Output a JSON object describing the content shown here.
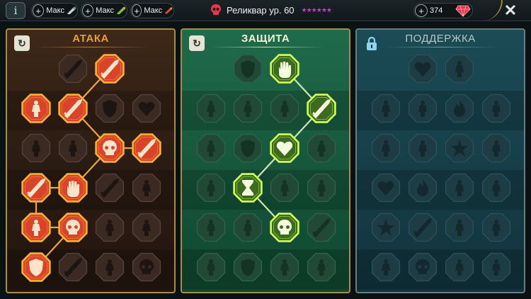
{
  "topbar": {
    "info_label": "i",
    "resources": [
      {
        "plus": "+",
        "label": "Макс",
        "icon": "silver-potion-icon"
      },
      {
        "plus": "+",
        "label": "Макс",
        "icon": "green-potion-icon"
      },
      {
        "plus": "+",
        "label": "Макс",
        "icon": "red-potion-icon"
      }
    ],
    "title": "Реликвар ур. 60",
    "stars": "★★★★★★",
    "gems_plus": "+",
    "gems_value": "374",
    "close_label": "✕",
    "colors": {
      "gem": "#e8364a",
      "stars": "#d233d8",
      "skull": "#e8364a"
    }
  },
  "panels": [
    {
      "id": "attack",
      "title": "АТАКА",
      "control": "reset",
      "control_glyph": "↻",
      "accent": "#f0902c",
      "nodes": [
        {
          "icon": "crossed-swords-icon",
          "state": "locked"
        },
        {
          "icon": "claw-slash-icon",
          "state": "active"
        },
        {
          "icon": "demon-icon",
          "state": "active"
        },
        {
          "icon": "blade-fan-icon",
          "state": "active"
        },
        {
          "icon": "shield-icon",
          "state": "locked"
        },
        {
          "icon": "heart-icon",
          "state": "locked"
        },
        {
          "icon": "warrior-icon",
          "state": "locked"
        },
        {
          "icon": "mask-icon",
          "state": "locked"
        },
        {
          "icon": "skull-icon",
          "state": "active"
        },
        {
          "icon": "reaper-icon",
          "state": "active"
        },
        {
          "icon": "dagger-icon",
          "state": "active"
        },
        {
          "icon": "fist-hammer-icon",
          "state": "active"
        },
        {
          "icon": "axe-icon",
          "state": "locked"
        },
        {
          "icon": "spider-icon",
          "state": "locked"
        },
        {
          "icon": "spider-legs-icon",
          "state": "active"
        },
        {
          "icon": "double-skull-icon",
          "state": "active"
        },
        {
          "icon": "pillar-icon",
          "state": "locked"
        },
        {
          "icon": "brute-icon",
          "state": "locked"
        },
        {
          "icon": "feather-icon",
          "state": "locked"
        },
        {
          "icon": "helmet-fire-icon",
          "state": "active"
        },
        {
          "icon": "horned-icon",
          "state": "locked"
        },
        {
          "icon": "skull-helmet-icon",
          "state": "locked"
        }
      ]
    },
    {
      "id": "defense",
      "title": "ЗАЩИТА",
      "control": "reset",
      "control_glyph": "↻",
      "accent": "#9be33a",
      "nodes": [
        {
          "icon": "armor-plate-icon",
          "state": "locked"
        },
        {
          "icon": "fist-icon",
          "state": "active"
        },
        {
          "icon": "cloak-icon",
          "state": "locked"
        },
        {
          "icon": "leaf-icon",
          "state": "locked"
        },
        {
          "icon": "warrior-icon",
          "state": "locked"
        },
        {
          "icon": "crossed-blades-icon",
          "state": "active"
        },
        {
          "icon": "figure-icon",
          "state": "locked"
        },
        {
          "icon": "shield-icon",
          "state": "locked"
        },
        {
          "icon": "heart-shield-icon",
          "state": "active"
        },
        {
          "icon": "knight-icon",
          "state": "locked"
        },
        {
          "icon": "statue-icon",
          "state": "locked"
        },
        {
          "icon": "hourglass-icon",
          "state": "active"
        },
        {
          "icon": "hand-icon",
          "state": "locked"
        },
        {
          "icon": "beast-icon",
          "state": "locked"
        },
        {
          "icon": "runner-icon",
          "state": "locked"
        },
        {
          "icon": "drops-icon",
          "state": "locked"
        },
        {
          "icon": "sun-skull-icon",
          "state": "active"
        },
        {
          "icon": "quill-icon",
          "state": "locked"
        },
        {
          "icon": "dancer-icon",
          "state": "locked"
        },
        {
          "icon": "gate-icon",
          "state": "locked"
        },
        {
          "icon": "tower-icon",
          "state": "locked"
        },
        {
          "icon": "saint-icon",
          "state": "locked"
        }
      ]
    },
    {
      "id": "support",
      "title": "ПОДДЕРЖКА",
      "control": "lock",
      "control_glyph": "🔒",
      "accent": "#7fa8b0",
      "nodes": [
        {
          "icon": "heart-hands-icon",
          "state": "locked"
        },
        {
          "icon": "wind-icon",
          "state": "locked"
        },
        {
          "icon": "prayer-icon",
          "state": "locked"
        },
        {
          "icon": "orb-icon",
          "state": "locked"
        },
        {
          "icon": "flame-icon",
          "state": "locked"
        },
        {
          "icon": "wave-icon",
          "state": "locked"
        },
        {
          "icon": "crowd-icon",
          "state": "locked"
        },
        {
          "icon": "warrior-icon",
          "state": "locked"
        },
        {
          "icon": "lightning-icon",
          "state": "locked"
        },
        {
          "icon": "ribbon-icon",
          "state": "locked"
        },
        {
          "icon": "heart-icon",
          "state": "locked"
        },
        {
          "icon": "comet-icon",
          "state": "locked"
        },
        {
          "icon": "book-icon",
          "state": "locked"
        },
        {
          "icon": "tentacle-icon",
          "state": "locked"
        },
        {
          "icon": "star-icon",
          "state": "locked"
        },
        {
          "icon": "feather-hand-icon",
          "state": "locked"
        },
        {
          "icon": "eye-icon",
          "state": "locked"
        },
        {
          "icon": "swirl-icon",
          "state": "locked"
        },
        {
          "icon": "bomb-icon",
          "state": "locked"
        },
        {
          "icon": "skull-icon",
          "state": "locked"
        },
        {
          "icon": "mask-icon",
          "state": "locked"
        },
        {
          "icon": "eagle-icon",
          "state": "locked"
        }
      ]
    }
  ]
}
